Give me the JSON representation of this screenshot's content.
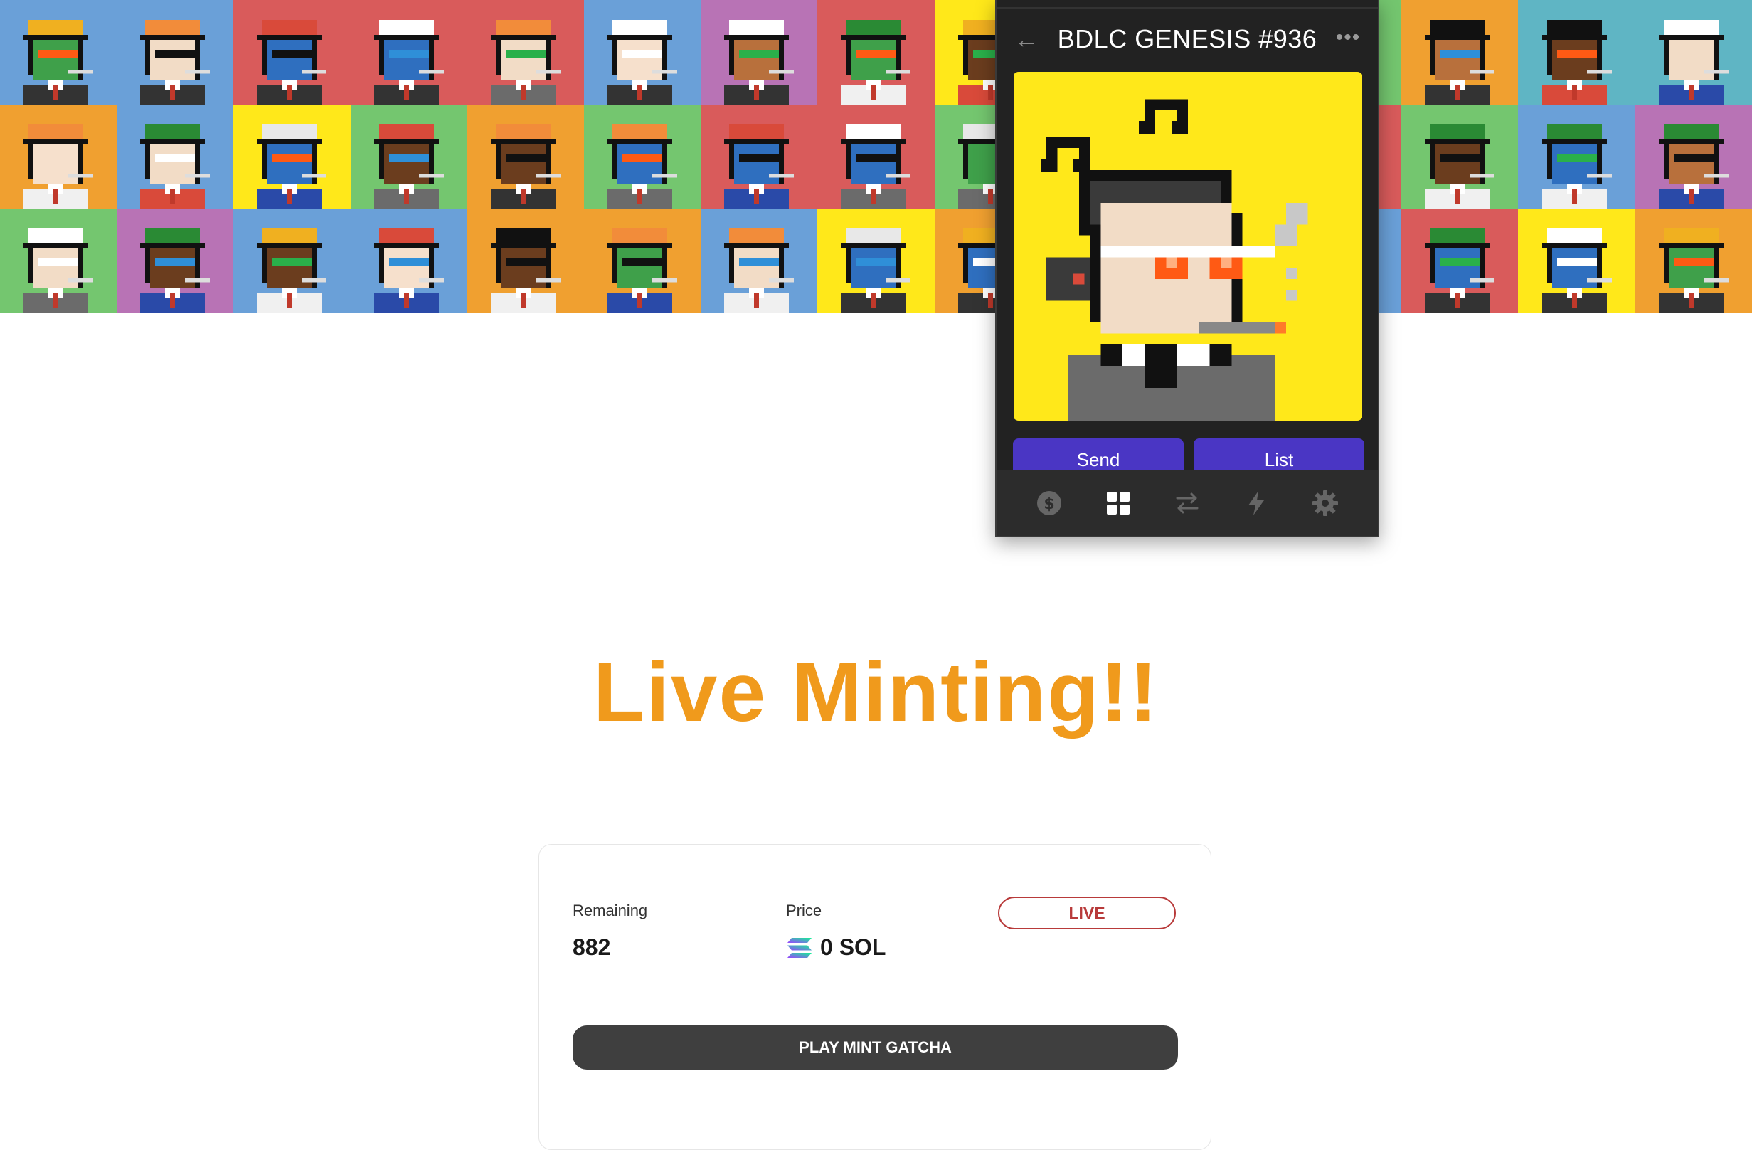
{
  "banner": {
    "description_tiles": 45,
    "colors": [
      "#74c66f",
      "#d95b5b",
      "#ffe81a",
      "#6aa0d8",
      "#b873b5",
      "#5fb5c4",
      "#f0a030"
    ]
  },
  "wallet": {
    "title": "BDLC GENESIS #936",
    "back_icon": "arrow-left-icon",
    "more_icon": "ellipsis-icon",
    "send_label": "Send",
    "list_label": "List",
    "nav": [
      "dollar-icon",
      "grid-icon",
      "swap-icon",
      "lightning-icon",
      "gear-icon"
    ],
    "nav_active": "grid-icon",
    "nft_background": "#ffe81a"
  },
  "headline": "Live Minting!!",
  "mint": {
    "remaining_label": "Remaining",
    "remaining_value": "882",
    "price_label": "Price",
    "price_value": "0 SOL",
    "status": "LIVE",
    "button_label": "PLAY MINT GATCHA"
  },
  "colors": {
    "headline": "#f09a1c",
    "live": "#b83a3a",
    "button": "#3f3f3f",
    "wallet_button": "#4a36c4"
  }
}
